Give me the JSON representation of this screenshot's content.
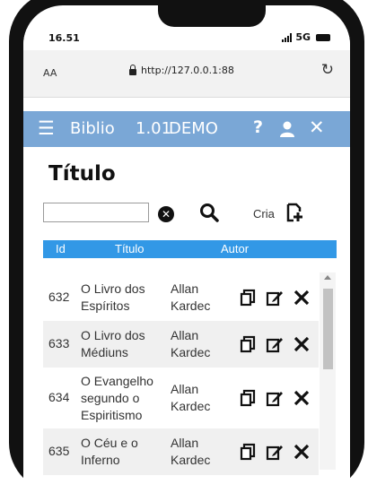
{
  "status_bar": {
    "time": "16.51",
    "network": "5G"
  },
  "browser": {
    "aa_label": "AA",
    "url": "http://127.0.0.1:88"
  },
  "app_bar": {
    "title": "Biblio",
    "version": "1.01",
    "mode": "DEMO",
    "help_label": "?"
  },
  "page": {
    "heading": "Título"
  },
  "search": {
    "value": "",
    "placeholder": ""
  },
  "create": {
    "label": "Cria"
  },
  "table": {
    "headers": {
      "id": "Id",
      "title": "Título",
      "author": "Autor"
    },
    "rows": [
      {
        "id": "632",
        "title": [
          "O Livro dos",
          "Espíritos"
        ],
        "author": [
          "Allan",
          "Kardec"
        ]
      },
      {
        "id": "633",
        "title": [
          "O Livro dos",
          "Médiuns"
        ],
        "author": [
          "Allan",
          "Kardec"
        ]
      },
      {
        "id": "634",
        "title": [
          "O Evangelho",
          "segundo o",
          "Espiritismo"
        ],
        "author": [
          "Allan",
          "Kardec"
        ]
      },
      {
        "id": "635",
        "title": [
          "O Céu e o",
          "Inferno"
        ],
        "author": [
          "Allan",
          "Kardec"
        ]
      }
    ]
  },
  "colors": {
    "app_bar": "#7aa7d6",
    "table_header": "#3298e6",
    "row_alt": "#f0f0f0"
  },
  "icons": {
    "copy": "copy-icon",
    "edit": "edit-icon",
    "delete": "delete-icon",
    "search": "search-icon",
    "add": "add-document-icon",
    "user": "user-icon"
  }
}
